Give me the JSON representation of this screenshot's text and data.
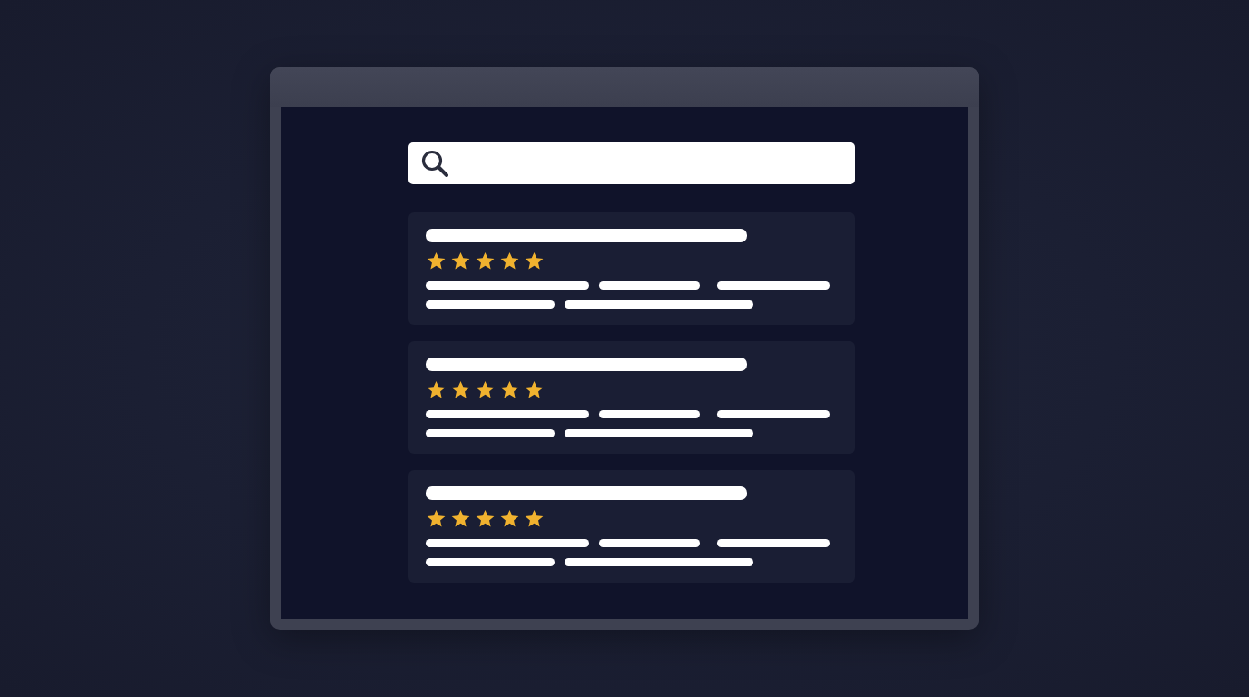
{
  "results": [
    {
      "stars": 5
    },
    {
      "stars": 5
    },
    {
      "stars": 5
    }
  ]
}
